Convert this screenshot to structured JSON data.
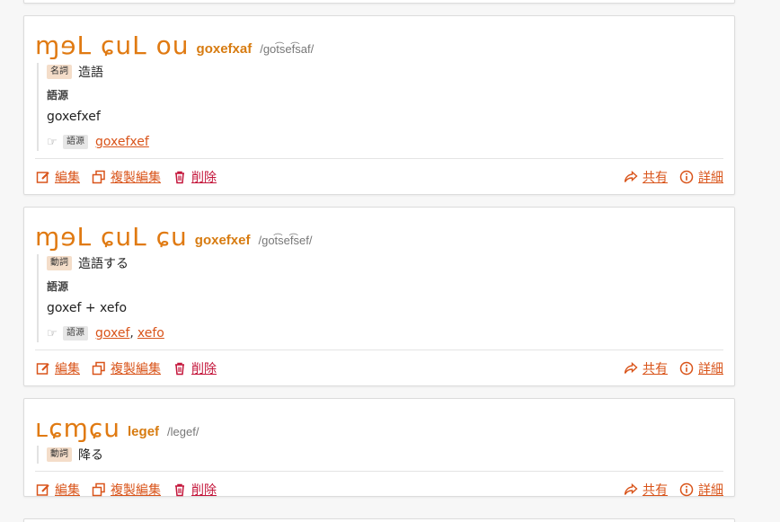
{
  "entries": [
    {
      "script": "ɱɘL ɕuL ou",
      "name": "goxefxaf",
      "pron": "/got͡sef͡saf/",
      "pos": "名詞",
      "definition": "造語",
      "etymology_label": "語源",
      "etymology_text": "goxefxef",
      "relation_tag": "語源",
      "links": [
        "goxefxef"
      ]
    },
    {
      "script": "ɱɘL ɕuL ɕu",
      "name": "goxefxef",
      "pron": "/got͡sef͡sef/",
      "pos": "動詞",
      "definition": "造語する",
      "etymology_label": "語源",
      "etymology_text": "goxef + xefo",
      "relation_tag": "語源",
      "links": [
        "goxef",
        "xefo"
      ],
      "link_separator": ","
    },
    {
      "script": "ʟɕɱɕu",
      "name": "legef",
      "pron": "/legef/",
      "pos": "動詞",
      "definition": "降る"
    }
  ],
  "actions": {
    "edit": "編集",
    "copy_edit": "複製編集",
    "delete": "削除",
    "share": "共有",
    "details": "詳細"
  },
  "colors": {
    "accent": "#d9541a",
    "title": "#d77b10",
    "danger": "#c4163b"
  }
}
